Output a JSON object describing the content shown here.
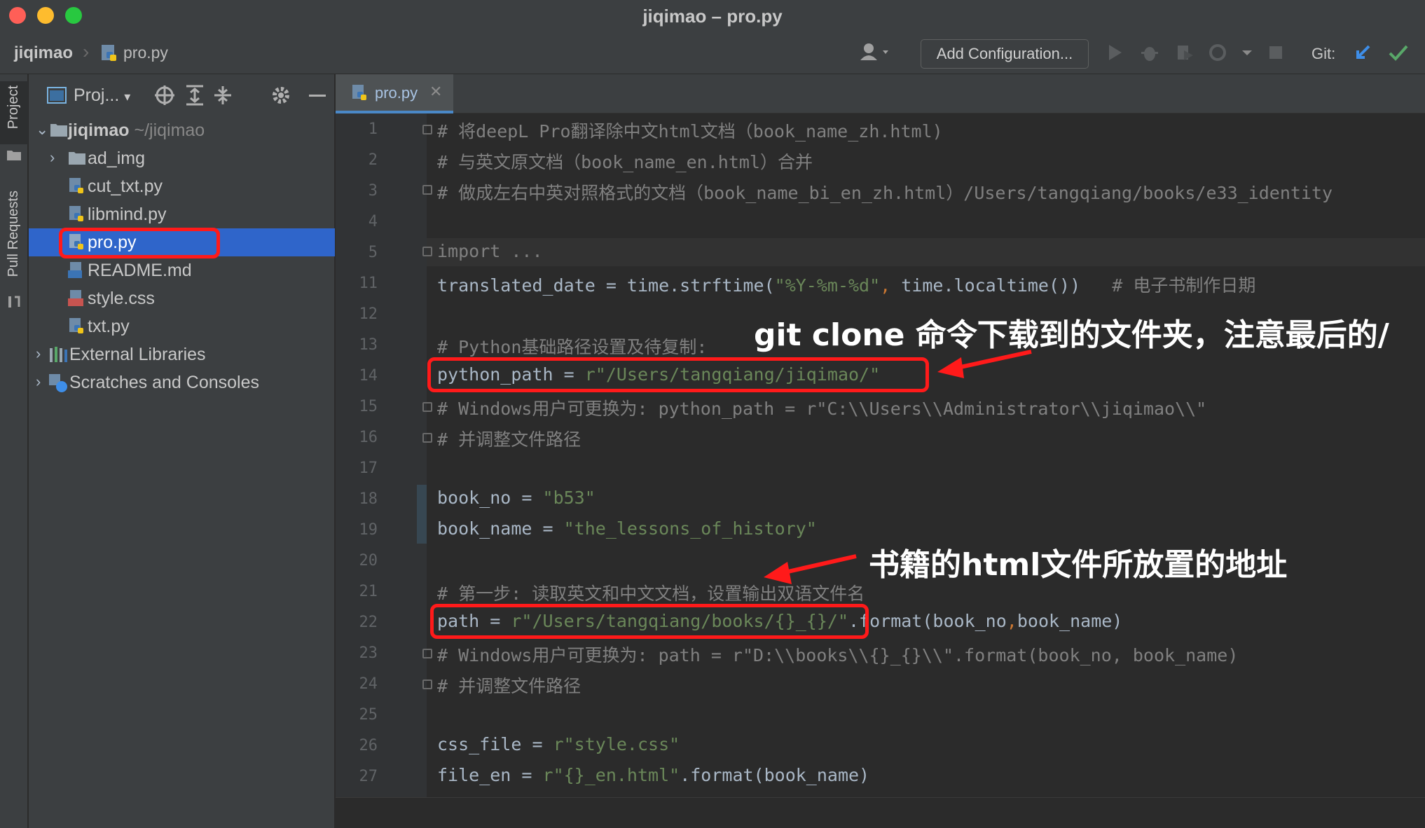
{
  "window": {
    "title": "jiqimao – pro.py"
  },
  "navbar": {
    "breadcrumb_root": "jiqimao",
    "breadcrumb_file": "pro.py",
    "add_configuration": "Add Configuration...",
    "git_label": "Git:"
  },
  "toolstrip": {
    "project": "Project",
    "pull_requests": "Pull Requests"
  },
  "project_panel": {
    "title": "Proj...",
    "tree": [
      {
        "label": "jiqimao",
        "suffix": "~/jiqimao",
        "type": "folder-root",
        "expanded": true
      },
      {
        "label": "ad_img",
        "type": "folder",
        "expanded": false
      },
      {
        "label": "cut_txt.py",
        "type": "python"
      },
      {
        "label": "libmind.py",
        "type": "python"
      },
      {
        "label": "pro.py",
        "type": "python",
        "selected": true
      },
      {
        "label": "README.md",
        "type": "markdown"
      },
      {
        "label": "style.css",
        "type": "css"
      },
      {
        "label": "txt.py",
        "type": "python"
      },
      {
        "label": "External Libraries",
        "type": "libraries"
      },
      {
        "label": "Scratches and Consoles",
        "type": "scratches"
      }
    ]
  },
  "editor": {
    "tab": "pro.py",
    "lines": [
      {
        "n": "1",
        "text": "# 将deepL Pro翻译除中文html文档（book_name_zh.html)"
      },
      {
        "n": "2",
        "text": "# 与英文原文档（book_name_en.html）合并"
      },
      {
        "n": "3",
        "text": "# 做成左右中英对照格式的文档（book_name_bi_en_zh.html）/Users/tangqiang/books/e33_identity"
      },
      {
        "n": "4",
        "text": ""
      },
      {
        "n": "5",
        "text": "import ..."
      },
      {
        "n": "11",
        "a": "translated_date = time.strftime(",
        "b": "\"%Y-%m-%d\"",
        "c": ", ",
        "d": "time.localtime())   ",
        "e": "# 电子书制作日期"
      },
      {
        "n": "12",
        "text": ""
      },
      {
        "n": "13",
        "text": "# Python基础路径设置及待复制:"
      },
      {
        "n": "14",
        "a": "python_path = ",
        "b": "r\"/Users/tangqiang/jiqimao/\""
      },
      {
        "n": "15",
        "text": "# Windows用户可更换为: python_path = r\"C:\\\\Users\\\\Administrator\\\\jiqimao\\\\\""
      },
      {
        "n": "16",
        "text": "# 并调整文件路径"
      },
      {
        "n": "17",
        "text": ""
      },
      {
        "n": "18",
        "a": "book_no = ",
        "b": "\"b53\""
      },
      {
        "n": "19",
        "a": "book_name = ",
        "b": "\"the_lessons_of_history\""
      },
      {
        "n": "20",
        "text": ""
      },
      {
        "n": "21",
        "text": "# 第一步: 读取英文和中文文档，设置输出双语文件名"
      },
      {
        "n": "22",
        "a": "path = ",
        "b": "r\"/Users/tangqiang/books/{}_{}/\"",
        "c": ".format(book_no",
        "d": ",",
        "e": "book_name)"
      },
      {
        "n": "23",
        "text": "# Windows用户可更换为: path = r\"D:\\\\books\\\\{}_{}\\\\\".format(book_no, book_name)"
      },
      {
        "n": "24",
        "text": "# 并调整文件路径"
      },
      {
        "n": "25",
        "text": ""
      },
      {
        "n": "26",
        "a": "css_file = ",
        "b": "r\"style.css\""
      },
      {
        "n": "27",
        "a": "file_en = ",
        "b": "r\"{}_en.html\"",
        "c": ".format(book_name)"
      }
    ]
  },
  "annotations": {
    "clone_note": "git clone 命令下载到的文件夹，注意最后的/",
    "books_note": "书籍的html文件所放置的地址"
  },
  "colors": {
    "highlight": "#ff1a1a",
    "selection": "#2f65ca",
    "string": "#6a8759",
    "comment": "#808080"
  }
}
